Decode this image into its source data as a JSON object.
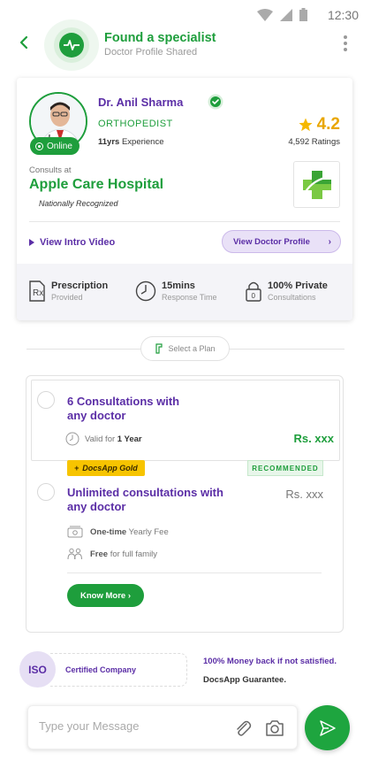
{
  "status_bar": {
    "time": "12:30",
    "icons": [
      "wifi-icon",
      "signal-icon",
      "battery-icon"
    ]
  },
  "header": {
    "title": "Found a specialist",
    "subtitle": "Doctor Profile Shared"
  },
  "doctor": {
    "name": "Dr. Anil Sharma",
    "specialty": "ORTHOPEDIST",
    "experience_value": "11yrs",
    "experience_label": "Experience",
    "status": "Online",
    "rating": "4.2",
    "ratings_count": "4,592 Ratings",
    "consults_at_label": "Consults at",
    "hospital": "Apple Care Hospital",
    "recognition": "Nationally Recognized",
    "intro_video": "View Intro Video",
    "view_profile": "View Doctor Profile"
  },
  "features": [
    {
      "title": "Prescription",
      "subtitle": "Provided",
      "icon": "prescription-icon"
    },
    {
      "title": "15mins",
      "subtitle": "Response Time",
      "icon": "clock-icon"
    },
    {
      "title": "100% Private",
      "subtitle": "Consultations",
      "icon": "lock-icon"
    }
  ],
  "plan_selector": {
    "label": "Select a Plan"
  },
  "plans": [
    {
      "title_line1": "6 Consultations with",
      "title_line2": "any doctor",
      "valid_prefix": "Valid for",
      "valid_value": "1 Year",
      "price": "Rs. xxx"
    },
    {
      "badge": "DocsApp Gold",
      "badge_prefix": "+",
      "recommended": "RECOMMENDED",
      "title_line1": "Unlimited consultations with",
      "title_line2": "any doctor",
      "price": "Rs. xxx",
      "feature1_bold": "One-time",
      "feature1_rest": "Yearly Fee",
      "feature2_bold": "Free",
      "feature2_rest": "for full family",
      "cta": "Know More"
    }
  ],
  "trust": {
    "iso": "ISO",
    "certified": "Certified Company",
    "money_back": "100% Money back if not satisfied.",
    "guarantee": "DocsApp Guarantee."
  },
  "composer": {
    "placeholder": "Type your Message"
  },
  "colors": {
    "brand_green": "#1e9e3c",
    "brand_purple": "#5b2ea6",
    "rating_gold": "#e9a600",
    "gold_badge": "#f7c400"
  }
}
